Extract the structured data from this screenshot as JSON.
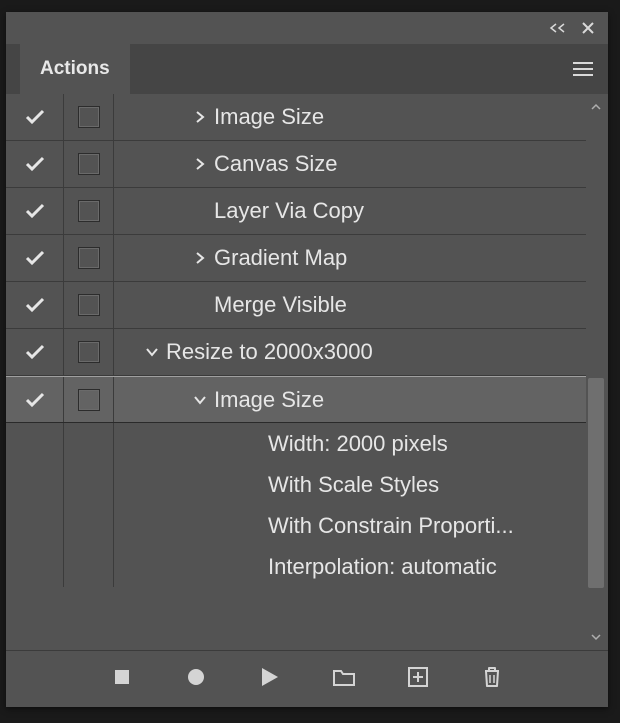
{
  "panel": {
    "title": "Actions"
  },
  "rows": [
    {
      "checked": true,
      "dialog": true,
      "indent": 100,
      "toggle": "right",
      "label": "Image Size",
      "selected": false
    },
    {
      "checked": true,
      "dialog": true,
      "indent": 100,
      "toggle": "right",
      "label": "Canvas Size",
      "selected": false
    },
    {
      "checked": true,
      "dialog": true,
      "indent": 100,
      "toggle": "none",
      "label": "Layer Via Copy",
      "selected": false
    },
    {
      "checked": true,
      "dialog": true,
      "indent": 100,
      "toggle": "right",
      "label": "Gradient Map",
      "selected": false
    },
    {
      "checked": true,
      "dialog": true,
      "indent": 100,
      "toggle": "none",
      "label": "Merge Visible",
      "selected": false
    },
    {
      "checked": true,
      "dialog": true,
      "indent": 52,
      "toggle": "down",
      "label": "Resize to 2000x3000",
      "selected": false
    },
    {
      "checked": true,
      "dialog": true,
      "indent": 100,
      "toggle": "down",
      "label": "Image Size",
      "selected": true
    }
  ],
  "details": [
    "Width: 2000 pixels",
    "With Scale Styles",
    "With Constrain Proporti...",
    "Interpolation: automatic"
  ],
  "detail_indent": 154,
  "footer": {
    "stop": "Stop",
    "record": "Record",
    "play": "Play",
    "folder": "New Set",
    "new": "New Action",
    "trash": "Delete"
  }
}
